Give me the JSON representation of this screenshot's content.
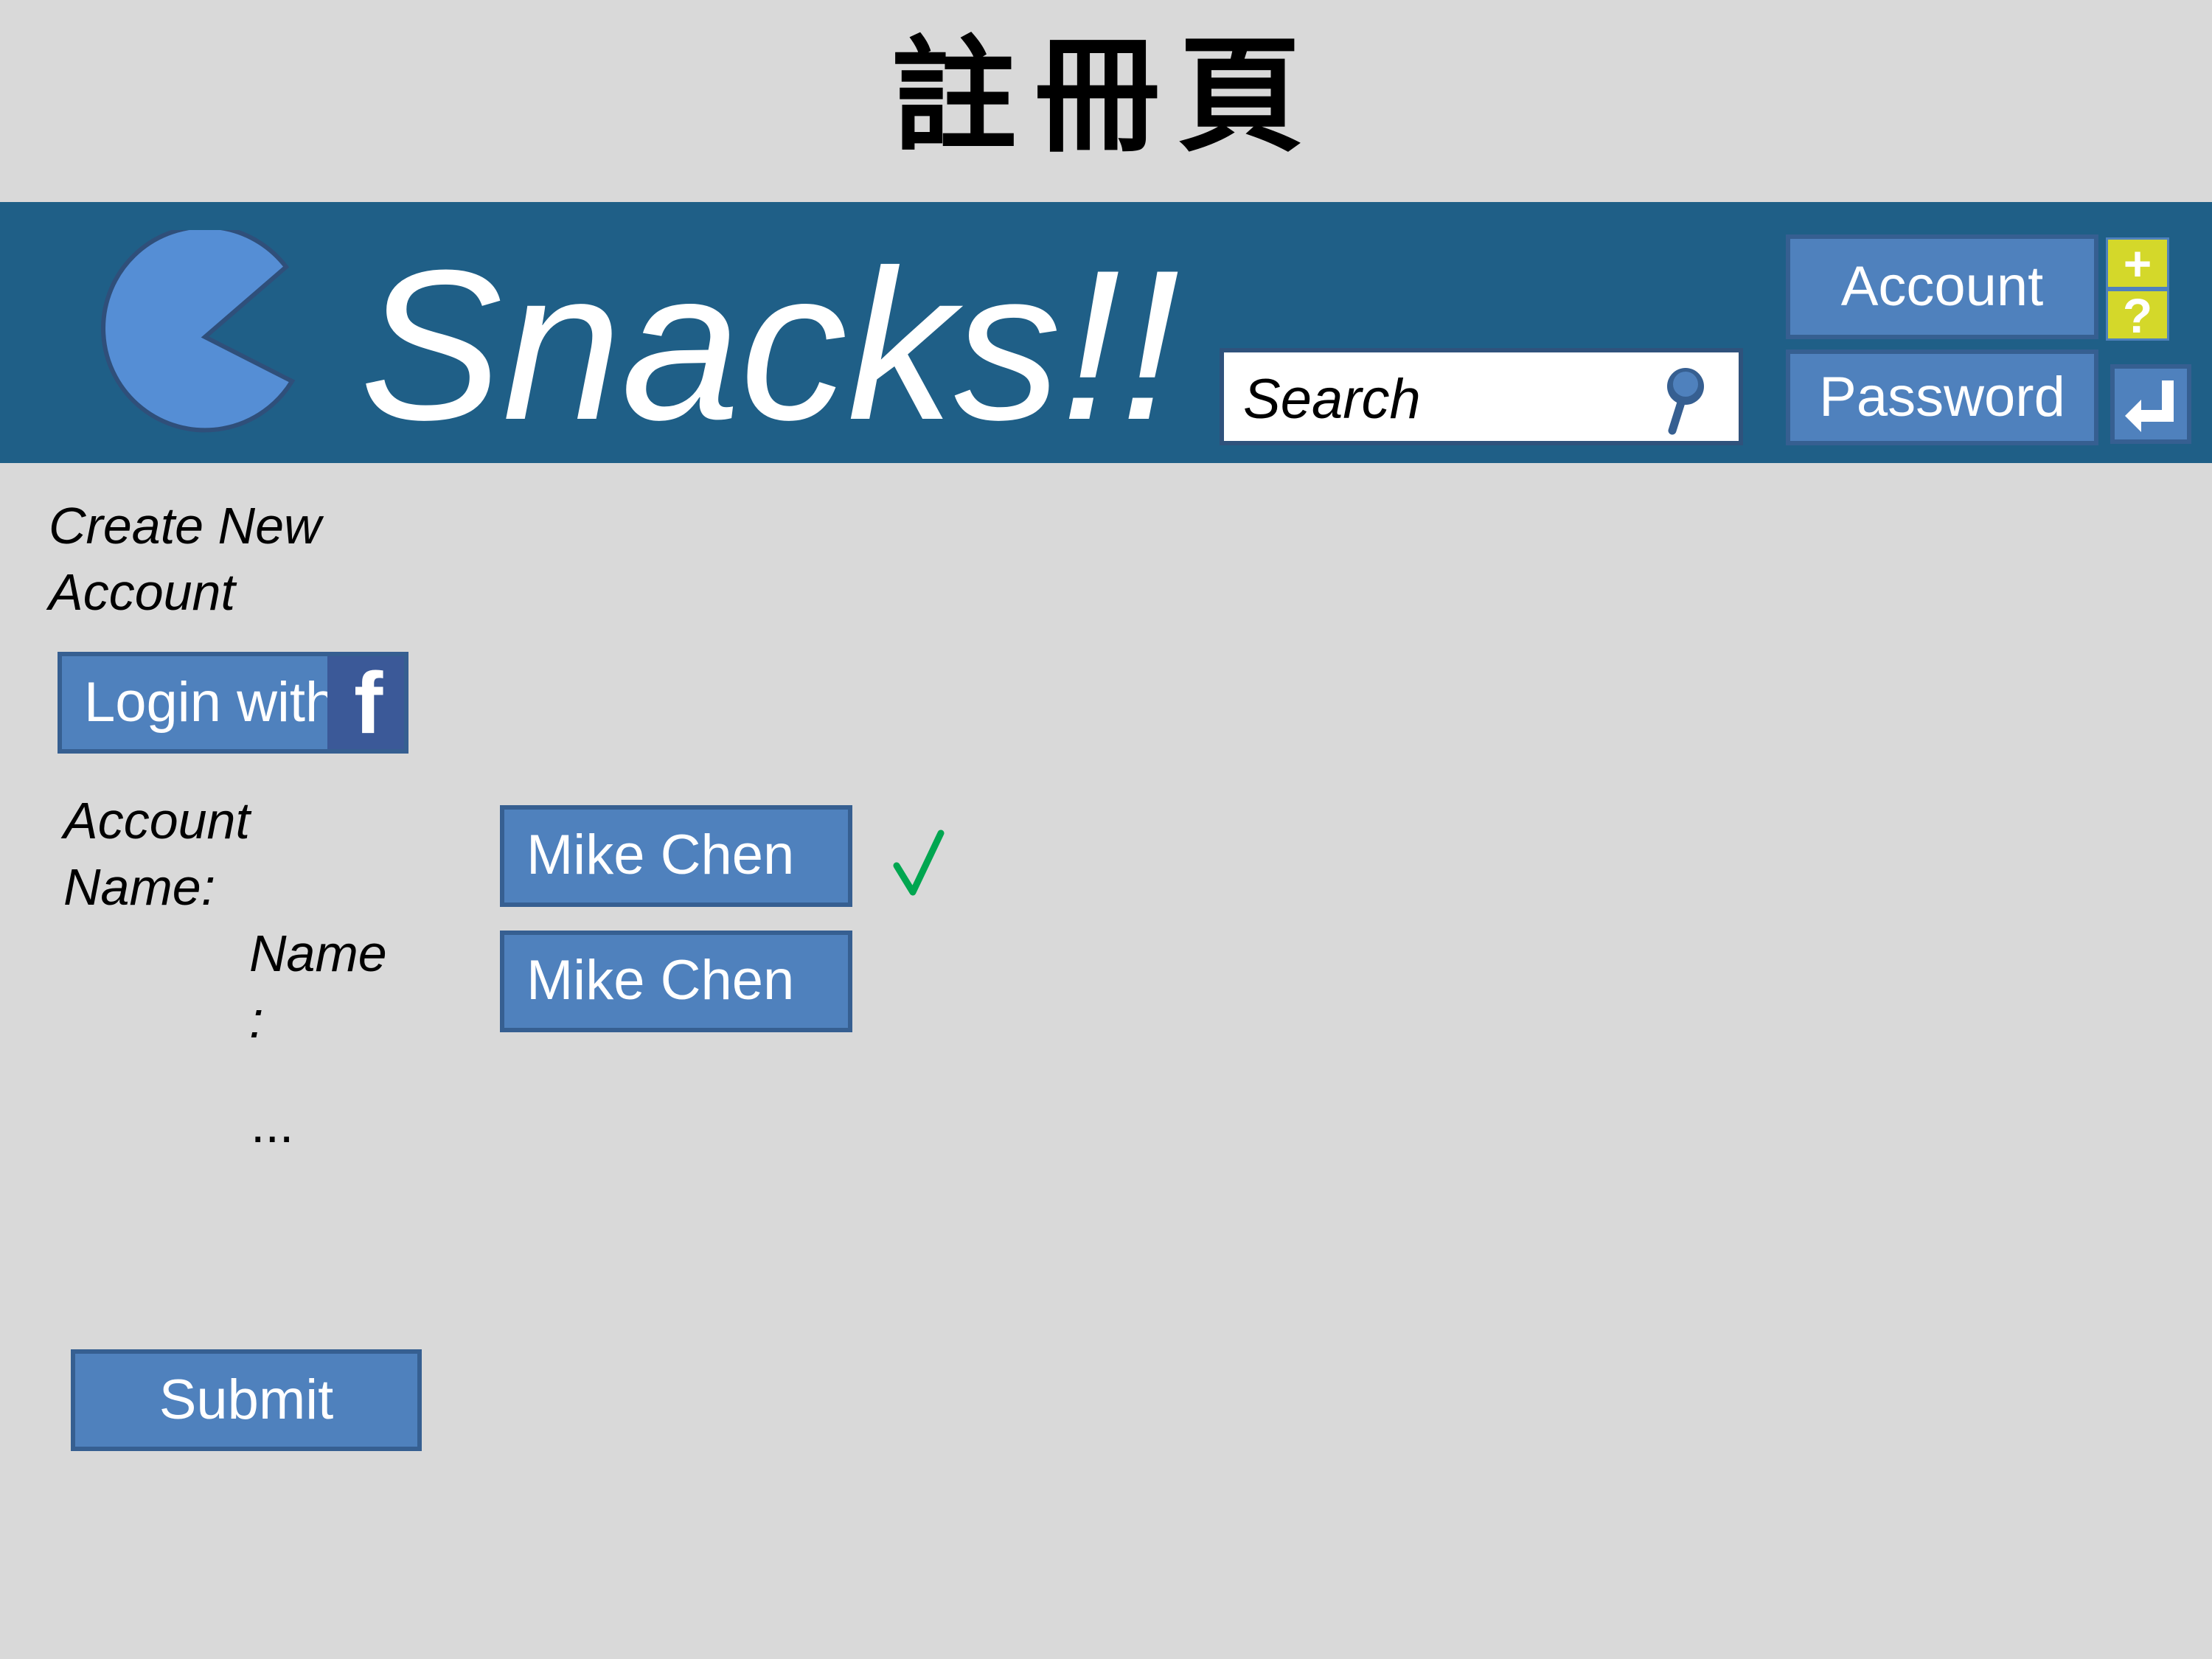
{
  "page": {
    "title": "註冊頁"
  },
  "header": {
    "logo_text": "Snacks!!",
    "search": {
      "placeholder": "Search"
    },
    "account_label": "Account",
    "password_label": "Password",
    "plus_label": "+",
    "help_label": "?"
  },
  "main": {
    "section_title_line1": "Create New",
    "section_title_line2": "Account",
    "login_with_label": "Login with",
    "fb_label": "f",
    "account_name_line1": "Account",
    "account_name_line2": "Name:",
    "account_name_value": "Mike Chen",
    "name_line1": "Name",
    "name_line2": ":",
    "name_value": "Mike Chen",
    "more_label": "...",
    "submit_label": "Submit"
  },
  "colors": {
    "page_bg": "#d9d9d9",
    "header_bg": "#1f5f87",
    "button_fill": "#4f81bd",
    "button_border": "#365f91",
    "logo_fill": "#558ed5",
    "yellow": "#d4d82a",
    "check_green": "#00a650",
    "facebook_blue": "#3b5998"
  },
  "icons": [
    "pacman-logo-icon",
    "pin-icon",
    "plus-icon",
    "question-icon",
    "enter-icon",
    "facebook-icon",
    "checkmark-icon"
  ]
}
